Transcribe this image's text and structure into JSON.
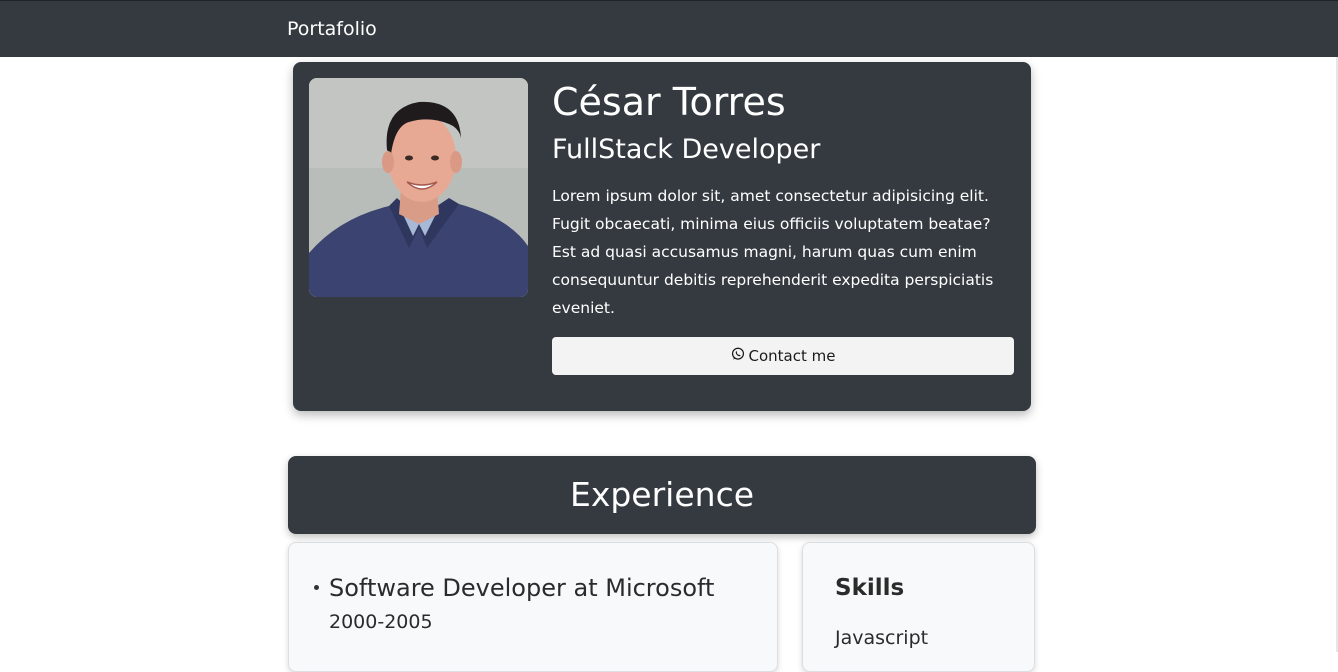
{
  "navbar": {
    "brand": "Portafolio"
  },
  "profile": {
    "name": "César Torres",
    "role": "FullStack Developer",
    "bio": "Lorem ipsum dolor sit, amet consectetur adipisicing elit. Fugit obcaecati, minima eius officiis voluptatem beatae? Est ad quasi accusamus magni, harum quas cum enim consequuntur debitis reprehenderit expedita perspiciatis eveniet.",
    "contact_label": "Contact me",
    "contact_icon": "whatsapp-icon"
  },
  "experience": {
    "title": "Experience",
    "jobs": [
      {
        "title": "Software Developer at Microsoft",
        "dates": "2000-2005"
      }
    ]
  },
  "skills": {
    "title": "Skills",
    "items": [
      "Javascript"
    ]
  },
  "colors": {
    "navbar_bg": "#343a40",
    "card_dark": "#343a40",
    "card_light": "#f8f9fa",
    "button_bg": "#f3f3f3"
  }
}
